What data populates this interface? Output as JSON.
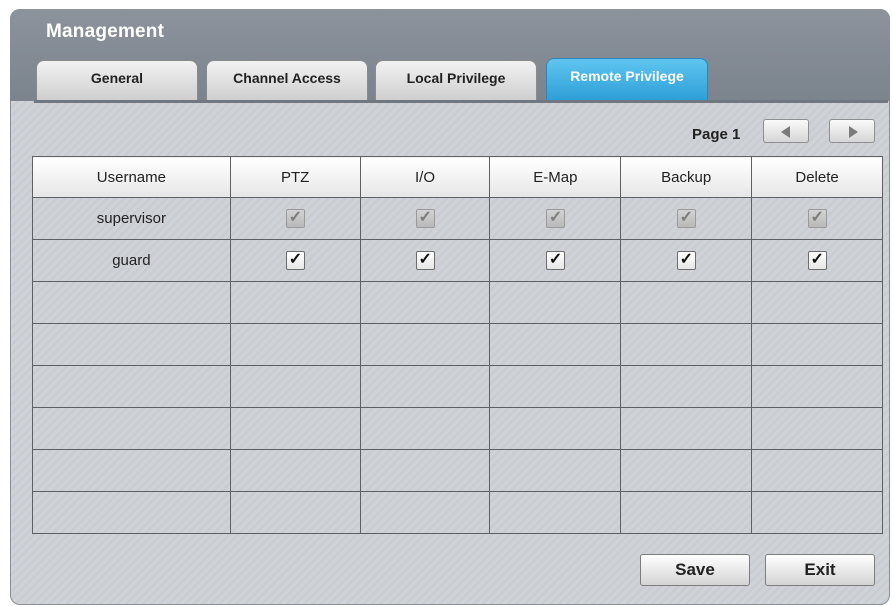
{
  "window": {
    "title": "Management"
  },
  "tabs": [
    {
      "label": "General",
      "active": false
    },
    {
      "label": "Channel Access",
      "active": false
    },
    {
      "label": "Local Privilege",
      "active": false
    },
    {
      "label": "Remote Privilege",
      "active": true
    }
  ],
  "pager": {
    "label": "Page 1",
    "prev_icon": "triangle-left-icon",
    "next_icon": "triangle-right-icon"
  },
  "table": {
    "columns": [
      "Username",
      "PTZ",
      "I/O",
      "E-Map",
      "Backup",
      "Delete"
    ],
    "rows": [
      {
        "username": "supervisor",
        "ptz": true,
        "io": true,
        "emap": true,
        "backup": true,
        "delete": true,
        "disabled": true
      },
      {
        "username": "guard",
        "ptz": true,
        "io": true,
        "emap": true,
        "backup": true,
        "delete": true,
        "disabled": false
      }
    ],
    "empty_rows": 6,
    "check_glyph": "✓"
  },
  "footer": {
    "save_label": "Save",
    "exit_label": "Exit"
  },
  "colors": {
    "active_tab": "#2f9fd8",
    "header": "#858c95"
  }
}
